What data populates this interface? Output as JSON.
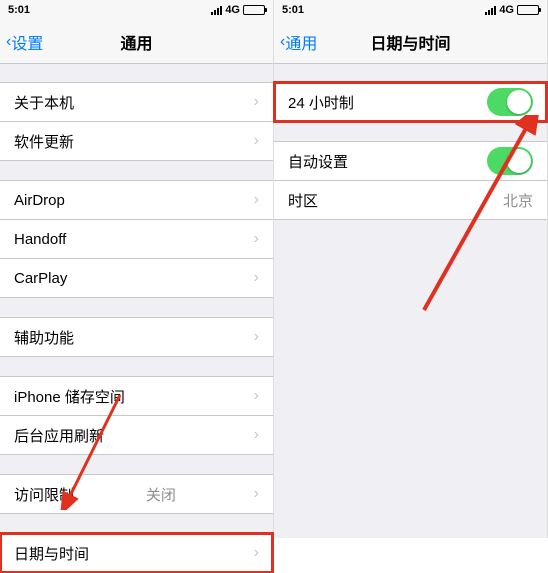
{
  "status": {
    "time": "5:01",
    "network": "4G"
  },
  "left": {
    "back": "设置",
    "title": "通用",
    "rows": {
      "about": "关于本机",
      "software_update": "软件更新",
      "airdrop": "AirDrop",
      "handoff": "Handoff",
      "carplay": "CarPlay",
      "accessibility": "辅助功能",
      "storage": "iPhone 储存空间",
      "background_refresh": "后台应用刷新",
      "restrictions": "访问限制",
      "restrictions_value": "关闭",
      "date_time": "日期与时间"
    }
  },
  "right": {
    "back": "通用",
    "title": "日期与时间",
    "rows": {
      "clock_24h": "24 小时制",
      "auto_set": "自动设置",
      "timezone": "时区",
      "timezone_value": "北京"
    }
  }
}
